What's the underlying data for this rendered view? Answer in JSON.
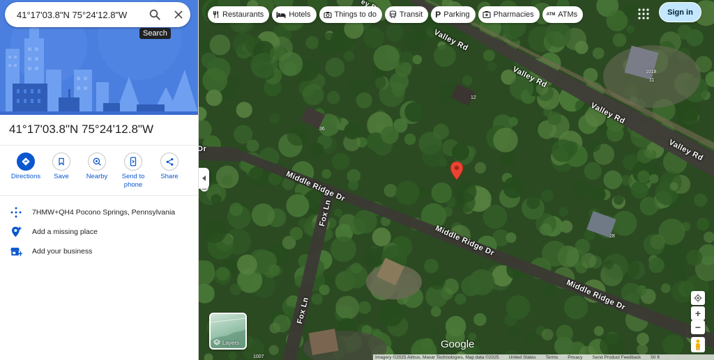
{
  "search": {
    "query": "41°17'03.8\"N 75°24'12.8\"W",
    "tooltip": "Search"
  },
  "place": {
    "title": "41°17'03.8\"N 75°24'12.8\"W"
  },
  "actions": [
    {
      "label": "Directions",
      "icon": "directions-icon"
    },
    {
      "label": "Save",
      "icon": "bookmark-icon"
    },
    {
      "label": "Nearby",
      "icon": "nearby-icon"
    },
    {
      "label": "Send to phone",
      "icon": "phone-icon"
    },
    {
      "label": "Share",
      "icon": "share-icon"
    }
  ],
  "info": {
    "plus_code": "7HMW+QH4 Pocono Springs, Pennsylvania",
    "add_place": "Add a missing place",
    "add_business": "Add your business"
  },
  "chips": [
    {
      "label": "Restaurants",
      "icon": "fork-knife-icon"
    },
    {
      "label": "Hotels",
      "icon": "bed-icon"
    },
    {
      "label": "Things to do",
      "icon": "camera-icon"
    },
    {
      "label": "Transit",
      "icon": "train-icon"
    },
    {
      "label": "Parking",
      "icon": "parking-icon"
    },
    {
      "label": "Pharmacies",
      "icon": "pharmacy-icon"
    },
    {
      "label": "ATMs",
      "icon": "atm-icon",
      "badge": "ATM"
    }
  ],
  "header": {
    "signin": "Sign in"
  },
  "roads": {
    "valley1": "Valley Rd",
    "valley2": "Valley Rd",
    "valley3": "Valley Rd",
    "valley4": "Valley Rd",
    "middle1": "Middle Ridge Dr",
    "middle2": "Middle Ridge Dr",
    "middle3": "Middle Ridge Dr",
    "fox1": "Fox Ln",
    "fox2": "Fox Ln",
    "dr_edge": "Dr",
    "top_edge": "ey R"
  },
  "house_numbers": {
    "n12": "12",
    "n36": "36",
    "n1018": "1018",
    "n11": "11",
    "n28": "28",
    "n1007": "1007"
  },
  "map": {
    "google": "Google",
    "layers": "Layers",
    "footer": {
      "imagery": "Imagery ©2025 Airbus, Maxar Technologies, Map data ©2025",
      "us": "United States",
      "terms": "Terms",
      "privacy": "Privacy",
      "feedback": "Send Product Feedback",
      "scale": "50 ft"
    }
  },
  "colors": {
    "accent": "#0b57d0",
    "pin": "#ea4335",
    "signin_bg": "#c2e7ff",
    "hero_bg": "#4a7fe0"
  }
}
